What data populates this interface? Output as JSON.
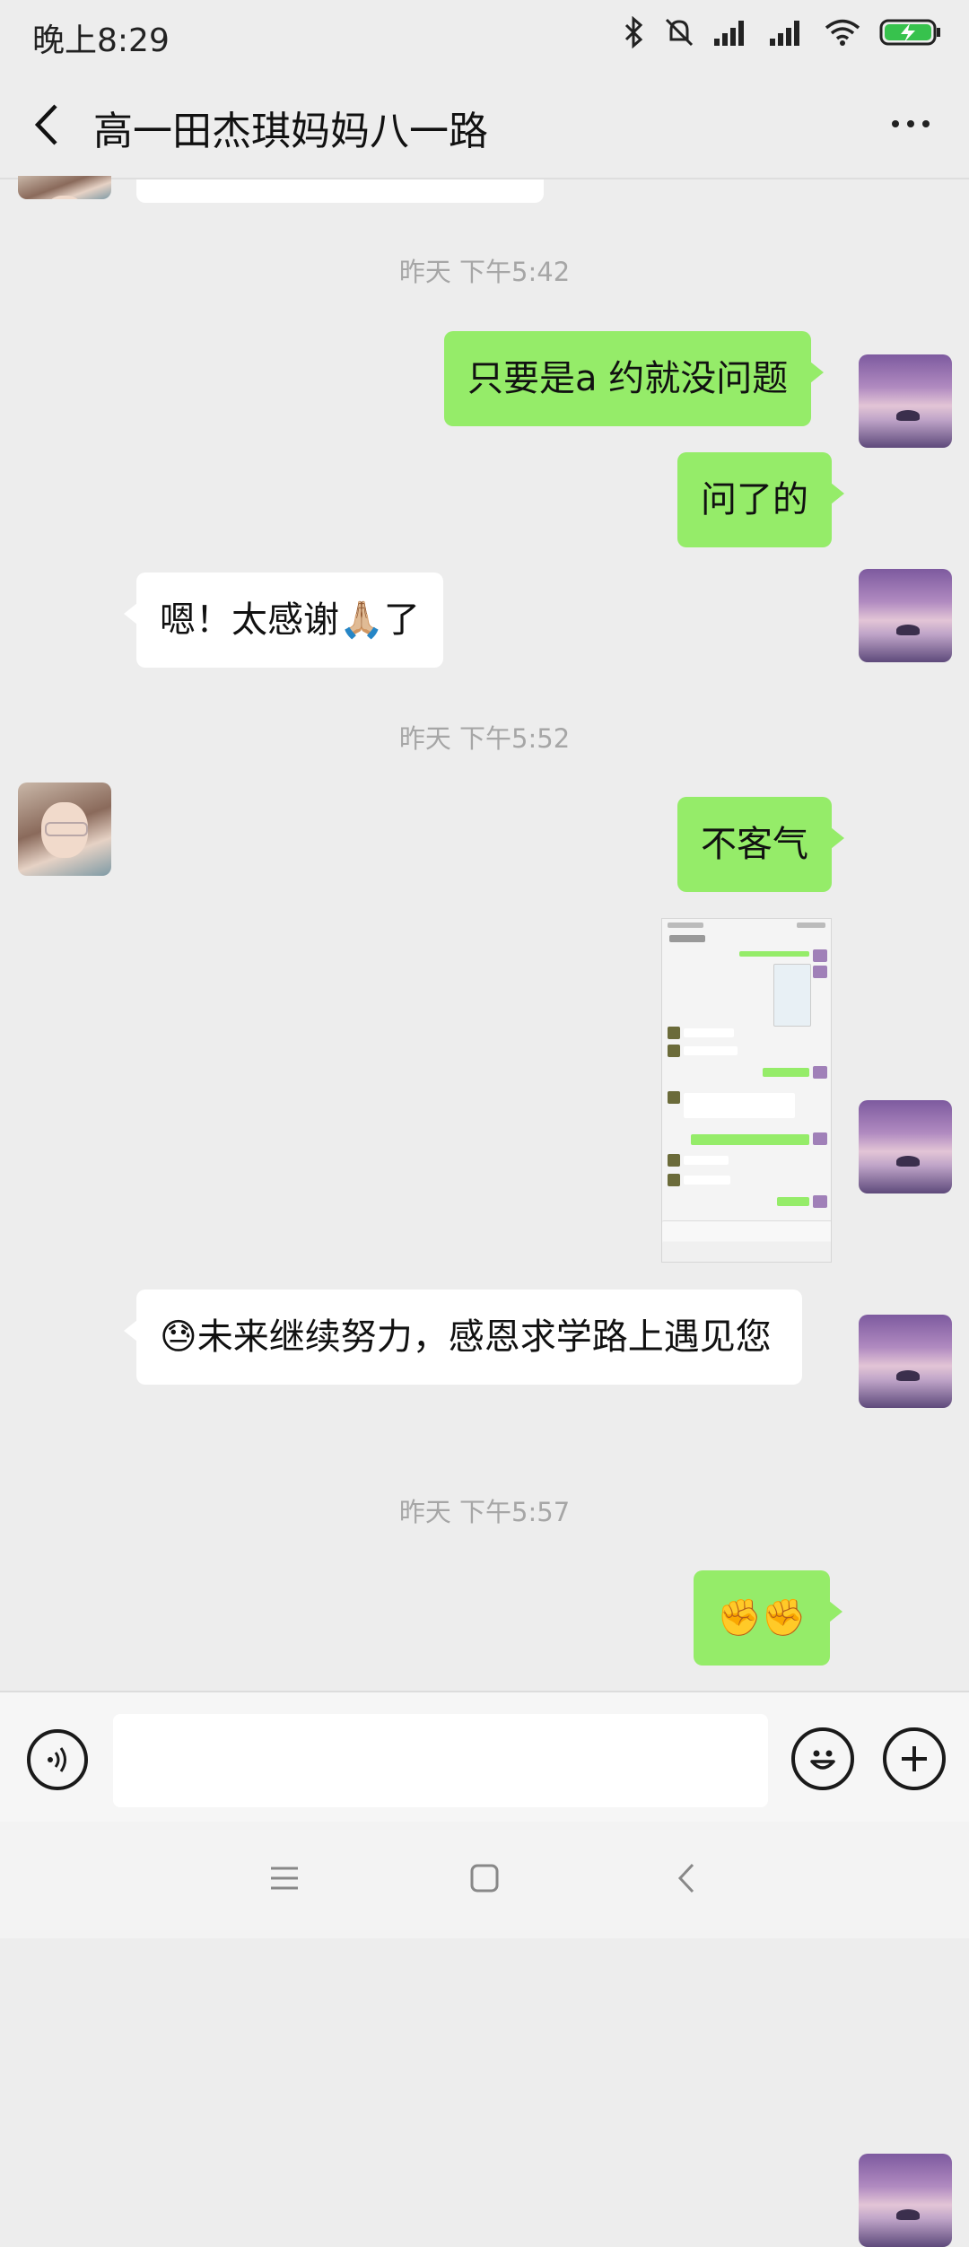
{
  "status_bar": {
    "time": "晚上8:29",
    "icons": [
      "bluetooth-icon",
      "mute-icon",
      "signal-icon",
      "signal-icon",
      "wifi-icon",
      "battery-charging-icon"
    ]
  },
  "header": {
    "title": "高一田杰琪妈妈八一路",
    "back_icon": "chevron-left-icon",
    "more_icon": "more-dots-icon"
  },
  "messages": {
    "ts1": "昨天 下午5:42",
    "m1": "只要是a 约就没问题",
    "m2": "问了的",
    "m3_pre": "嗯！太感谢",
    "m3_emoji": "🙏🏼",
    "m3_post": "了",
    "ts2": "昨天 下午5:52",
    "m4": "不客气",
    "m6_emoji": "😓",
    "m6_text": "未来继续努力，感恩求学路上遇见您",
    "ts3": "昨天 下午5:57",
    "m7": "✊✊"
  },
  "shared_image": {
    "description_icon": "image-icon"
  },
  "input_bar": {
    "voice_icon": "voice-icon",
    "emoji_icon": "emoji-icon",
    "plus_icon": "plus-icon",
    "value": ""
  },
  "nav_bar": {
    "icons": [
      "menu-icon",
      "home-square-icon",
      "back-icon"
    ]
  },
  "colors": {
    "my_bubble": "#95ec69",
    "other_bubble": "#ffffff",
    "background": "#ededed",
    "timestamp": "#a6a6a6"
  }
}
